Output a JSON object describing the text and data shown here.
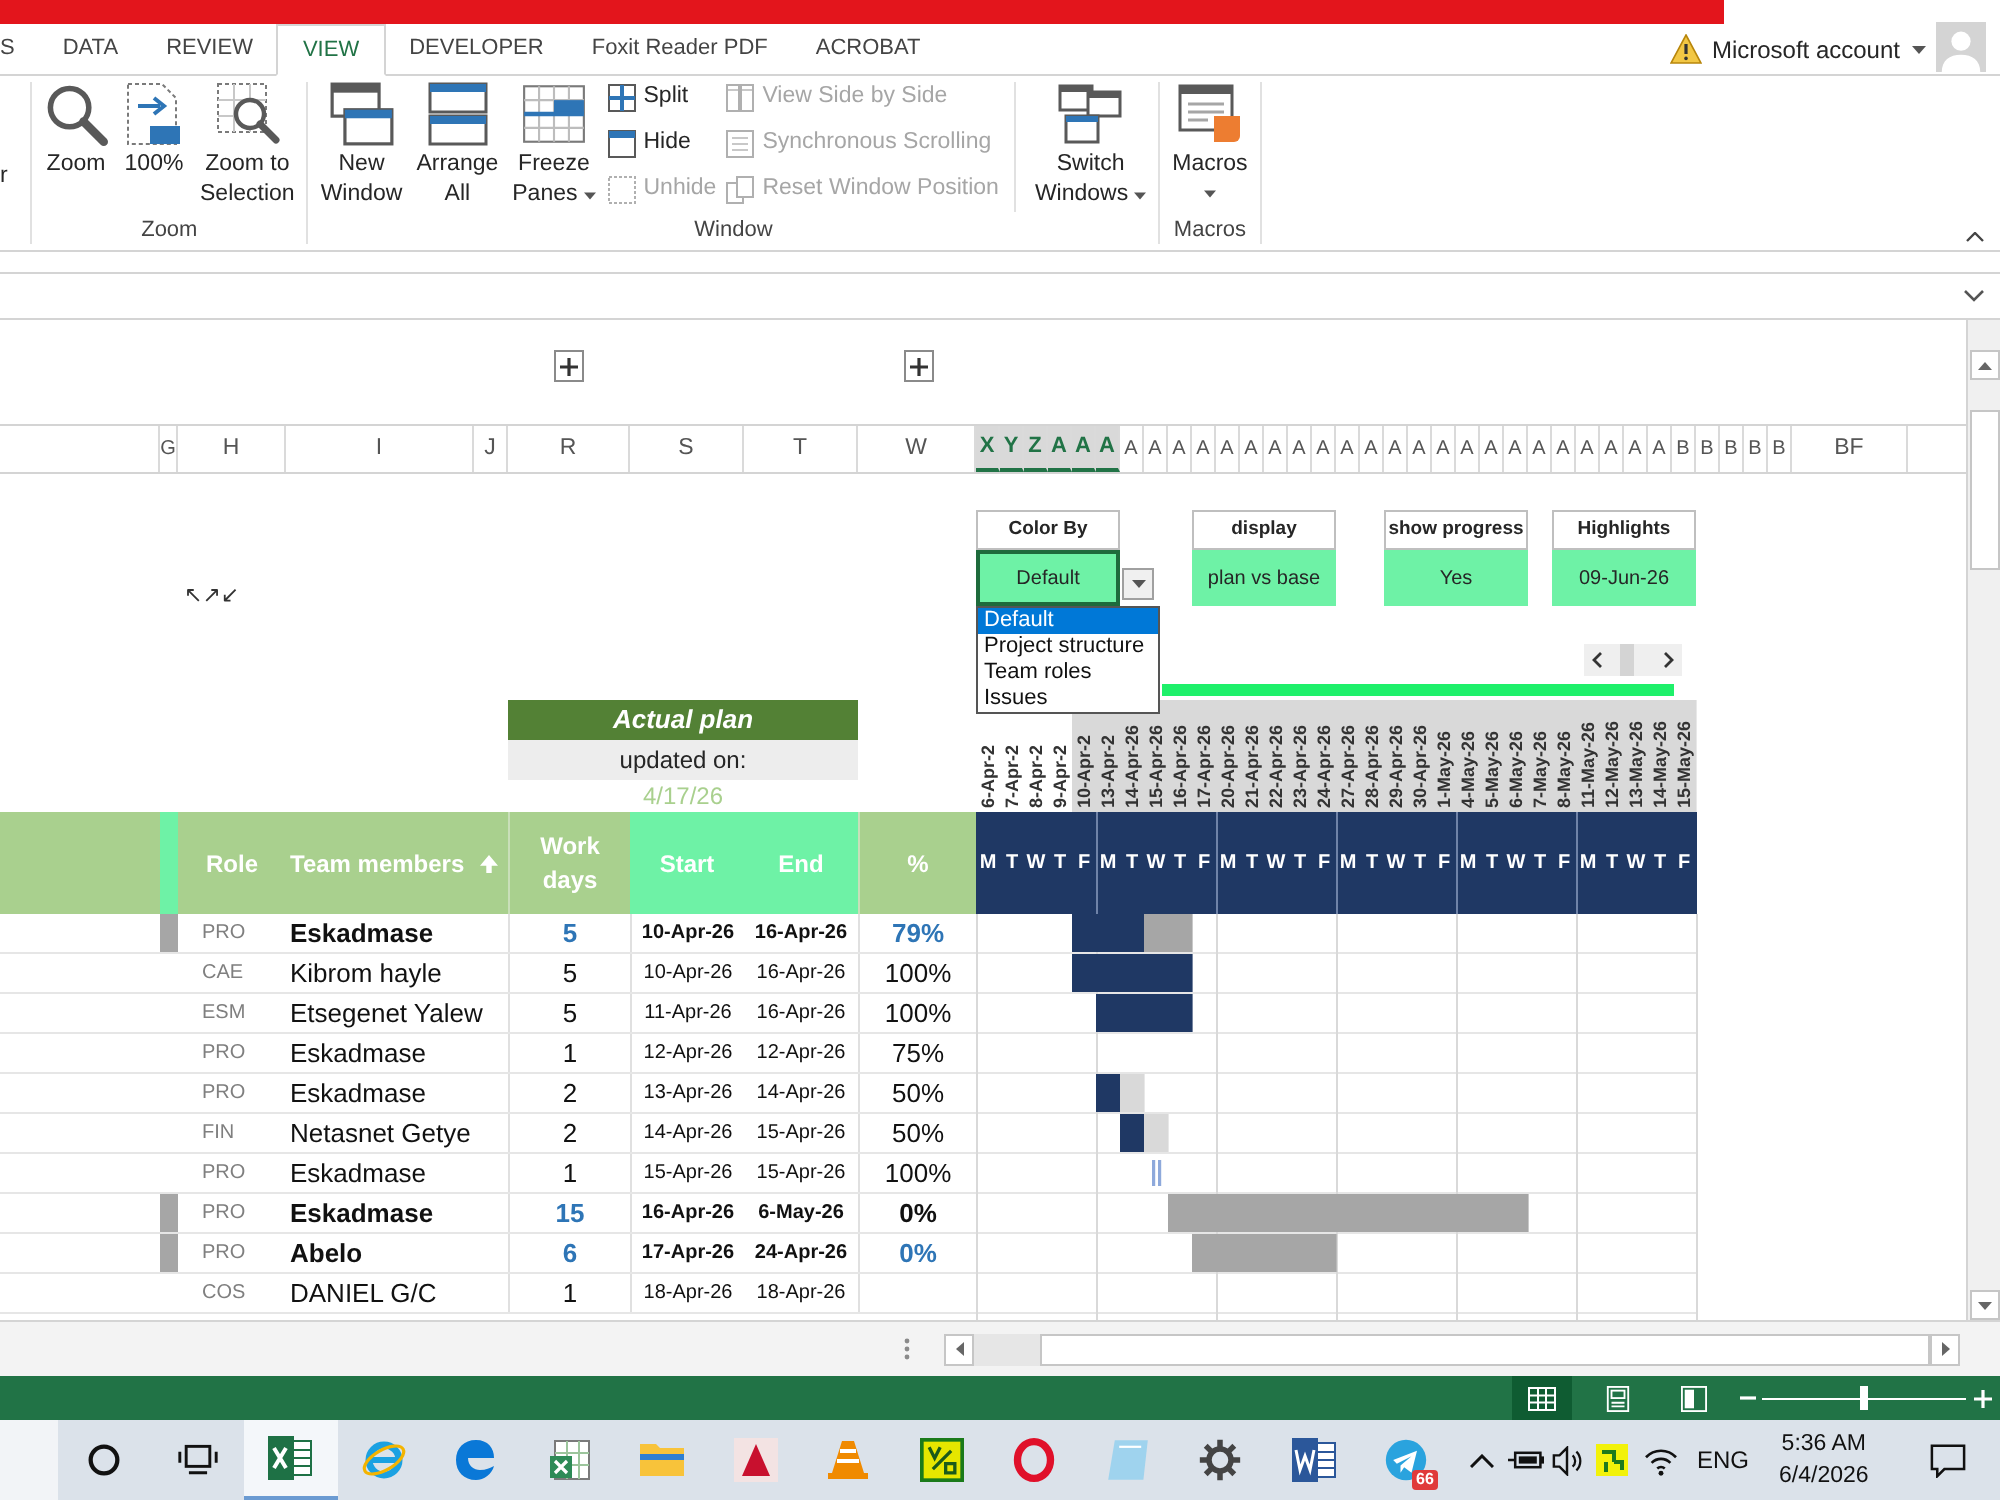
{
  "ribbon": {
    "tabs": [
      {
        "label": "S",
        "selected": false
      },
      {
        "label": "DATA",
        "selected": false
      },
      {
        "label": "REVIEW",
        "selected": false
      },
      {
        "label": "VIEW",
        "selected": true
      },
      {
        "label": "DEVELOPER",
        "selected": false
      },
      {
        "label": "Foxit Reader PDF",
        "selected": false
      },
      {
        "label": "ACROBAT",
        "selected": false
      }
    ],
    "account": "Microsoft account",
    "cut_button": "r",
    "groups": [
      {
        "label": "Zoom",
        "commands": [
          {
            "kind": "large",
            "lines": [
              "Zoom"
            ],
            "dropdown": false
          },
          {
            "kind": "large",
            "lines": [
              "100%"
            ],
            "dropdown": false
          },
          {
            "kind": "large",
            "lines": [
              "Zoom to",
              "Selection"
            ],
            "dropdown": false
          }
        ]
      },
      {
        "label": "Window",
        "commands": [
          {
            "kind": "large",
            "lines": [
              "New",
              "Window"
            ],
            "dropdown": false
          },
          {
            "kind": "large",
            "lines": [
              "Arrange",
              "All"
            ],
            "dropdown": false
          },
          {
            "kind": "large",
            "lines": [
              "Freeze",
              "Panes"
            ],
            "dropdown": true
          },
          {
            "kind": "stack",
            "items": [
              {
                "label": "Split",
                "disabled": false
              },
              {
                "label": "Hide",
                "disabled": false
              },
              {
                "label": "Unhide",
                "disabled": true
              }
            ]
          },
          {
            "kind": "stack",
            "items": [
              {
                "label": "View Side by Side",
                "disabled": true
              },
              {
                "label": "Synchronous Scrolling",
                "disabled": true
              },
              {
                "label": "Reset Window Position",
                "disabled": true
              }
            ]
          },
          {
            "kind": "separator"
          },
          {
            "kind": "large",
            "lines": [
              "Switch",
              "Windows"
            ],
            "dropdown": true
          }
        ]
      },
      {
        "label": "Macros",
        "commands": [
          {
            "kind": "large",
            "lines": [
              "Macros"
            ],
            "dropdown": true
          }
        ]
      }
    ]
  },
  "sheet": {
    "column_headers": [
      {
        "label": "G",
        "selected": false
      },
      {
        "label": "H",
        "selected": false
      },
      {
        "label": "I",
        "selected": false
      },
      {
        "label": "J",
        "selected": false
      },
      {
        "label": "R",
        "selected": false
      },
      {
        "label": "S",
        "selected": false
      },
      {
        "label": "T",
        "selected": false
      },
      {
        "label": "W",
        "selected": false
      },
      {
        "label": "X",
        "selected": true
      },
      {
        "label": "Y",
        "selected": true
      },
      {
        "label": "Z",
        "selected": true
      },
      {
        "label": "A",
        "selected": true
      },
      {
        "label": "A",
        "selected": true
      },
      {
        "label": "A",
        "selected": true
      },
      {
        "label": "A",
        "selected": false
      },
      {
        "label": "A",
        "selected": false
      },
      {
        "label": "A",
        "selected": false
      },
      {
        "label": "A",
        "selected": false
      },
      {
        "label": "A",
        "selected": false
      },
      {
        "label": "A",
        "selected": false
      },
      {
        "label": "A",
        "selected": false
      },
      {
        "label": "A",
        "selected": false
      },
      {
        "label": "A",
        "selected": false
      },
      {
        "label": "A",
        "selected": false
      },
      {
        "label": "A",
        "selected": false
      },
      {
        "label": "A",
        "selected": false
      },
      {
        "label": "A",
        "selected": false
      },
      {
        "label": "A",
        "selected": false
      },
      {
        "label": "A",
        "selected": false
      },
      {
        "label": "A",
        "selected": false
      },
      {
        "label": "A",
        "selected": false
      },
      {
        "label": "A",
        "selected": false
      },
      {
        "label": "A",
        "selected": false
      },
      {
        "label": "A",
        "selected": false
      },
      {
        "label": "A",
        "selected": false
      },
      {
        "label": "A",
        "selected": false
      },
      {
        "label": "A",
        "selected": false
      },
      {
        "label": "B",
        "selected": false
      },
      {
        "label": "B",
        "selected": false
      },
      {
        "label": "B",
        "selected": false
      },
      {
        "label": "B",
        "selected": false
      },
      {
        "label": "B",
        "selected": false
      },
      {
        "label": "BF",
        "selected": false
      }
    ],
    "controls": [
      {
        "label": "Color By",
        "value": "Default",
        "selected": true
      },
      {
        "label": "display",
        "value": "plan vs base",
        "selected": false
      },
      {
        "label": "show progress",
        "value": "Yes",
        "selected": false
      },
      {
        "label": "Highlights",
        "value": "09-Jun-26",
        "selected": false
      }
    ],
    "dropdown_options": [
      {
        "label": "Default",
        "selected": true
      },
      {
        "label": "Project structure",
        "selected": false
      },
      {
        "label": "Team roles",
        "selected": false
      },
      {
        "label": "Issues",
        "selected": false
      }
    ],
    "arrows": "↖↗↙",
    "actual_plan": {
      "title": "Actual plan",
      "subtitle": "updated on:",
      "date": "4/17/26"
    },
    "gantt": {
      "dates": [
        {
          "label": "6-Apr-2",
          "highlighted": false
        },
        {
          "label": "7-Apr-2",
          "highlighted": false
        },
        {
          "label": "8-Apr-2",
          "highlighted": false
        },
        {
          "label": "9-Apr-2",
          "highlighted": false
        },
        {
          "label": "10-Apr-2",
          "highlighted": true
        },
        {
          "label": "13-Apr-2",
          "highlighted": true
        },
        {
          "label": "14-Apr-26",
          "highlighted": true
        },
        {
          "label": "15-Apr-26",
          "highlighted": true
        },
        {
          "label": "16-Apr-26",
          "highlighted": true
        },
        {
          "label": "17-Apr-26",
          "highlighted": true
        },
        {
          "label": "20-Apr-26",
          "highlighted": true
        },
        {
          "label": "21-Apr-26",
          "highlighted": true
        },
        {
          "label": "22-Apr-26",
          "highlighted": true
        },
        {
          "label": "23-Apr-26",
          "highlighted": true
        },
        {
          "label": "24-Apr-26",
          "highlighted": true
        },
        {
          "label": "27-Apr-26",
          "highlighted": true
        },
        {
          "label": "28-Apr-26",
          "highlighted": true
        },
        {
          "label": "29-Apr-26",
          "highlighted": true
        },
        {
          "label": "30-Apr-26",
          "highlighted": true
        },
        {
          "label": "1-May-26",
          "highlighted": true
        },
        {
          "label": "4-May-26",
          "highlighted": true
        },
        {
          "label": "5-May-26",
          "highlighted": true
        },
        {
          "label": "6-May-26",
          "highlighted": true
        },
        {
          "label": "7-May-26",
          "highlighted": true
        },
        {
          "label": "8-May-26",
          "highlighted": true
        },
        {
          "label": "11-May-26",
          "highlighted": true
        },
        {
          "label": "12-May-26",
          "highlighted": true
        },
        {
          "label": "13-May-26",
          "highlighted": true
        },
        {
          "label": "14-May-26",
          "highlighted": true
        },
        {
          "label": "15-May-26",
          "highlighted": true
        }
      ],
      "day_letters": [
        "M",
        "T",
        "W",
        "T",
        "F",
        "M",
        "T",
        "W",
        "T",
        "F",
        "M",
        "T",
        "W",
        "T",
        "F",
        "M",
        "T",
        "W",
        "T",
        "F",
        "M",
        "T",
        "W",
        "T",
        "F",
        "M",
        "T",
        "W",
        "T",
        "F"
      ]
    },
    "table": {
      "columns": [
        "Role",
        "Team members",
        "Work days",
        "Start",
        "End",
        "%"
      ],
      "rows": [
        {
          "kind": "summary",
          "role": "PRO",
          "name": "Eskadmase",
          "days": "5",
          "start": "10-Apr-26",
          "end": "16-Apr-26",
          "percent": "79%",
          "percent_highlighted": true,
          "timeline": [
            {
              "kind": "empty"
            },
            {
              "kind": "empty"
            },
            {
              "kind": "empty"
            },
            {
              "kind": "empty"
            },
            {
              "kind": "done"
            },
            {
              "kind": "done"
            },
            {
              "kind": "done"
            },
            {
              "kind": "remaining"
            },
            {
              "kind": "remaining"
            }
          ]
        },
        {
          "kind": "task",
          "role": "CAE",
          "name": "Kibrom hayle",
          "days": "5",
          "start": "10-Apr-26",
          "end": "16-Apr-26",
          "percent": "100%",
          "percent_highlighted": false,
          "timeline": [
            {
              "kind": "empty"
            },
            {
              "kind": "empty"
            },
            {
              "kind": "empty"
            },
            {
              "kind": "empty"
            },
            {
              "kind": "done"
            },
            {
              "kind": "done"
            },
            {
              "kind": "done"
            },
            {
              "kind": "done"
            },
            {
              "kind": "done"
            }
          ]
        },
        {
          "kind": "task",
          "role": "ESM",
          "name": "Etsegenet Yalew",
          "days": "5",
          "start": "11-Apr-26",
          "end": "16-Apr-26",
          "percent": "100%",
          "percent_highlighted": false,
          "timeline": [
            {
              "kind": "empty"
            },
            {
              "kind": "empty"
            },
            {
              "kind": "empty"
            },
            {
              "kind": "empty"
            },
            {
              "kind": "empty"
            },
            {
              "kind": "done"
            },
            {
              "kind": "done"
            },
            {
              "kind": "done"
            },
            {
              "kind": "done"
            }
          ]
        },
        {
          "kind": "task",
          "role": "PRO",
          "name": "Eskadmase",
          "days": "1",
          "start": "12-Apr-26",
          "end": "12-Apr-26",
          "percent": "75%",
          "percent_highlighted": false
        },
        {
          "kind": "task",
          "role": "PRO",
          "name": "Eskadmase",
          "days": "2",
          "start": "13-Apr-26",
          "end": "14-Apr-26",
          "percent": "50%",
          "percent_highlighted": false,
          "timeline": [
            {
              "kind": "empty"
            },
            {
              "kind": "empty"
            },
            {
              "kind": "empty"
            },
            {
              "kind": "empty"
            },
            {
              "kind": "empty"
            },
            {
              "kind": "done"
            },
            {
              "kind": "remaining"
            }
          ]
        },
        {
          "kind": "task",
          "role": "FIN",
          "name": "Netasnet Getye",
          "days": "2",
          "start": "14-Apr-26",
          "end": "15-Apr-26",
          "percent": "50%",
          "percent_highlighted": false,
          "timeline": [
            {
              "kind": "empty"
            },
            {
              "kind": "empty"
            },
            {
              "kind": "empty"
            },
            {
              "kind": "empty"
            },
            {
              "kind": "empty"
            },
            {
              "kind": "empty"
            },
            {
              "kind": "done"
            },
            {
              "kind": "remaining"
            }
          ]
        },
        {
          "kind": "task",
          "role": "PRO",
          "name": "Eskadmase",
          "days": "1",
          "start": "15-Apr-26",
          "end": "15-Apr-26",
          "percent": "100%",
          "percent_highlighted": false,
          "timeline": [
            {
              "kind": "empty"
            },
            {
              "kind": "empty"
            },
            {
              "kind": "empty"
            },
            {
              "kind": "empty"
            },
            {
              "kind": "empty"
            },
            {
              "kind": "empty"
            },
            {
              "kind": "empty"
            },
            {
              "kind": "milestone"
            }
          ]
        },
        {
          "kind": "summary",
          "role": "PRO",
          "name": "Eskadmase",
          "days": "15",
          "start": "16-Apr-26",
          "end": "6-May-26",
          "percent": "0%",
          "percent_highlighted": false,
          "timeline": [
            {
              "kind": "empty"
            },
            {
              "kind": "empty"
            },
            {
              "kind": "empty"
            },
            {
              "kind": "empty"
            },
            {
              "kind": "empty"
            },
            {
              "kind": "empty"
            },
            {
              "kind": "empty"
            },
            {
              "kind": "empty"
            },
            {
              "kind": "remaining"
            },
            {
              "kind": "remaining"
            },
            {
              "kind": "remaining"
            },
            {
              "kind": "remaining"
            },
            {
              "kind": "remaining"
            },
            {
              "kind": "remaining"
            },
            {
              "kind": "remaining"
            },
            {
              "kind": "remaining"
            },
            {
              "kind": "remaining"
            },
            {
              "kind": "remaining"
            },
            {
              "kind": "remaining"
            },
            {
              "kind": "remaining"
            },
            {
              "kind": "remaining"
            },
            {
              "kind": "remaining"
            },
            {
              "kind": "remaining"
            }
          ]
        },
        {
          "kind": "summary",
          "role": "PRO",
          "name": "Abelo",
          "days": "6",
          "start": "17-Apr-26",
          "end": "24-Apr-26",
          "percent": "0%",
          "percent_highlighted": true,
          "timeline": [
            {
              "kind": "empty"
            },
            {
              "kind": "empty"
            },
            {
              "kind": "empty"
            },
            {
              "kind": "empty"
            },
            {
              "kind": "empty"
            },
            {
              "kind": "empty"
            },
            {
              "kind": "empty"
            },
            {
              "kind": "empty"
            },
            {
              "kind": "empty"
            },
            {
              "kind": "remaining"
            },
            {
              "kind": "remaining"
            },
            {
              "kind": "remaining"
            },
            {
              "kind": "remaining"
            },
            {
              "kind": "remaining"
            },
            {
              "kind": "remaining"
            }
          ]
        },
        {
          "kind": "task",
          "role": "COS",
          "name": "DANIEL G/C",
          "days": "1",
          "start": "18-Apr-26",
          "end": "18-Apr-26"
        }
      ]
    }
  },
  "status_bar": {
    "views": [
      {
        "selected": true
      },
      {
        "selected": false
      },
      {
        "selected": false
      }
    ],
    "zoom": {
      "level": 0.5
    }
  },
  "taskbar": {
    "apps": [
      {
        "selected": false
      },
      {
        "selected": false
      },
      {
        "selected": true
      },
      {
        "selected": false
      },
      {
        "selected": false
      },
      {
        "selected": false
      },
      {
        "selected": false
      },
      {
        "selected": false
      },
      {
        "selected": false
      },
      {
        "selected": false
      },
      {
        "selected": false
      },
      {
        "selected": false
      },
      {
        "selected": false
      },
      {
        "selected": false
      },
      {
        "selected": false,
        "badge": "66"
      }
    ],
    "tray": {
      "language": "ENG",
      "time": "5:36 AM",
      "date": "6/4/2026"
    }
  }
}
